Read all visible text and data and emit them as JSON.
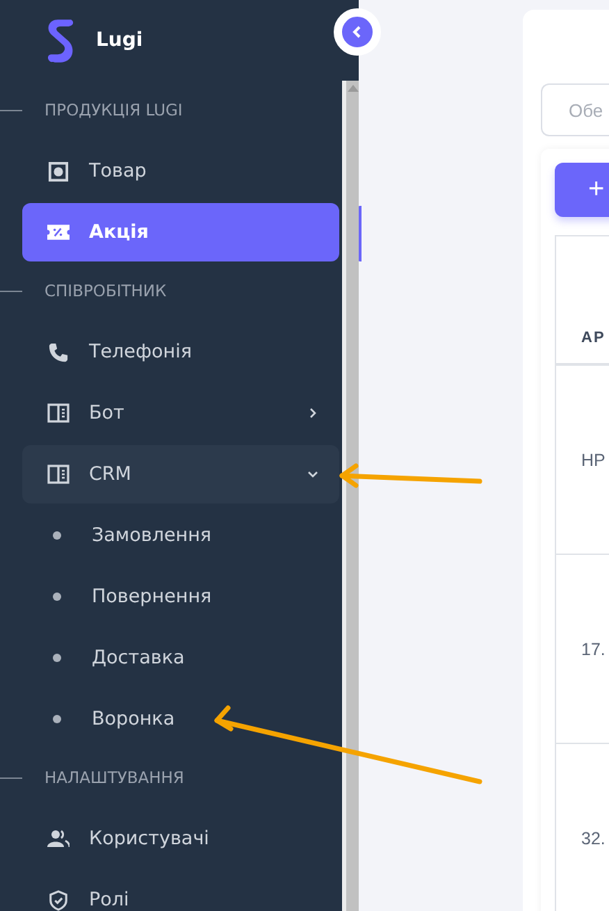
{
  "brand": {
    "name": "Lugi"
  },
  "sidebar": {
    "sections": [
      {
        "title": "ПРОДУКЦІЯ LUGI",
        "items": [
          {
            "label": "Товар",
            "kind": "link",
            "selected": false
          },
          {
            "label": "Акція",
            "kind": "link",
            "selected": true
          }
        ]
      },
      {
        "title": "СПІВРОБІТНИК",
        "items": [
          {
            "label": "Телефонія",
            "kind": "link",
            "selected": false
          },
          {
            "label": "Бот",
            "kind": "group",
            "selected": false,
            "expanded": false
          },
          {
            "label": "CRM",
            "kind": "group",
            "selected": false,
            "expanded": true,
            "children": [
              {
                "label": "Замовлення",
                "selected": false
              },
              {
                "label": "Повернення",
                "selected": false
              },
              {
                "label": "Доставка",
                "selected": false
              },
              {
                "label": "Воронка",
                "selected": false
              }
            ]
          }
        ]
      },
      {
        "title": "НАЛАШТУВАННЯ",
        "items": [
          {
            "label": "Користувачі",
            "kind": "link",
            "selected": false
          },
          {
            "label": "Ролі",
            "kind": "link",
            "selected": false
          }
        ]
      }
    ]
  },
  "main": {
    "search": {
      "placeholder": "Обе"
    },
    "add_button": "+",
    "table": {
      "columns": [
        "АР"
      ],
      "rows": [
        [
          "НР"
        ],
        [
          "17."
        ],
        [
          "32."
        ]
      ]
    }
  }
}
